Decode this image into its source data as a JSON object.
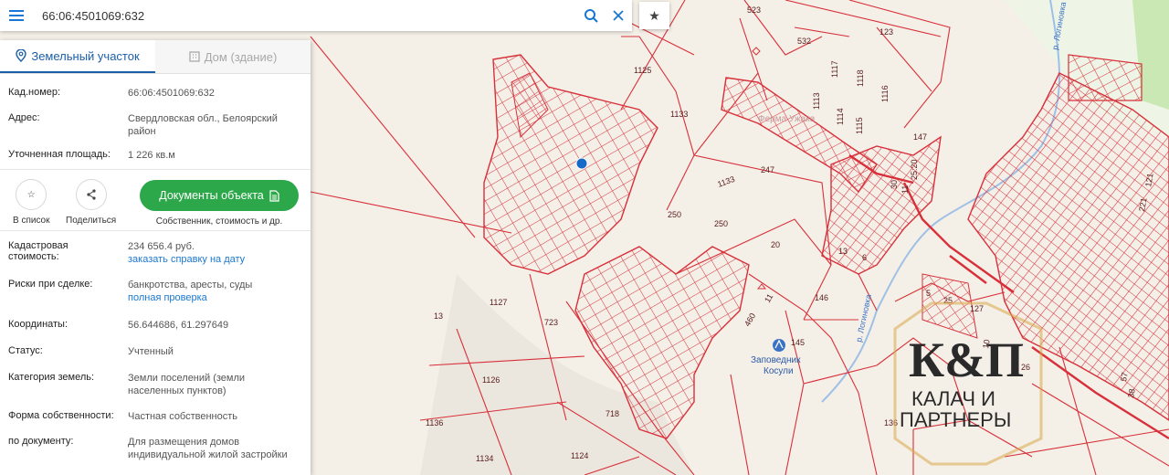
{
  "search": {
    "value": "66:06:4501069:632"
  },
  "tabs": [
    {
      "label": "Земельный участок"
    },
    {
      "label": "Дом (здание)"
    }
  ],
  "info": {
    "cad_label": "Кад.номер:",
    "cad_value": "66:06:4501069:632",
    "address_label": "Адрес:",
    "address_value": "Свердловская обл., Белоярский район",
    "area_label": "Уточненная площадь:",
    "area_value": "1 226 кв.м"
  },
  "actions": {
    "list_label": "В список",
    "share_label": "Поделиться",
    "docs_label": "Документы объекта",
    "docs_sub": "Собственник, стоимость и др."
  },
  "details": {
    "cost_label": "Кадастровая стоимость:",
    "cost_value": "234 656.4 руб.",
    "cost_link": "заказать справку на дату",
    "risk_label": "Риски при сделке:",
    "risk_value": "банкротства, аресты, суды",
    "risk_link": "полная проверка",
    "coord_label": "Координаты:",
    "coord_value": "56.644686, 61.297649",
    "status_label": "Статус:",
    "status_value": "Учтенный",
    "category_label": "Категория земель:",
    "category_value": "Земли поселений (земли населенных пунктов)",
    "ownership_label": "Форма собственности:",
    "ownership_value": "Частная собственность",
    "doc_label": "по документу:",
    "doc_value": "Для размещения домов индивидуальной жилой застройки"
  },
  "map": {
    "parcel_labels": [
      "523",
      "532",
      "123",
      "1125",
      "1133",
      "1117",
      "1118",
      "1116",
      "1113",
      "1114",
      "1115",
      "147",
      "247",
      "1133",
      "250",
      "250",
      "20",
      "13",
      "6",
      "1127",
      "723",
      "1126",
      "718",
      "1124",
      "1134",
      "1136",
      "13",
      "146",
      "145",
      "127",
      "460",
      "11",
      "5",
      "25",
      "26",
      "136",
      "38",
      "57",
      "10",
      "221",
      "121",
      "25:20",
      "30",
      "11"
    ],
    "river_labels": [
      "р. Логиновка",
      "р. Логиновка"
    ],
    "poi_label_1": "Заповедник",
    "poi_label_2": "Косули",
    "faded_label": "Ферма Ужака"
  },
  "logo": {
    "line1": "К&П",
    "line2": "КАЛАЧ И",
    "line3": "ПАРТНЕРЫ"
  },
  "colors": {
    "accent": "#1b78d0",
    "green": "#2ca84a",
    "parcel": "#d8303a",
    "marker": "#1769c8"
  }
}
